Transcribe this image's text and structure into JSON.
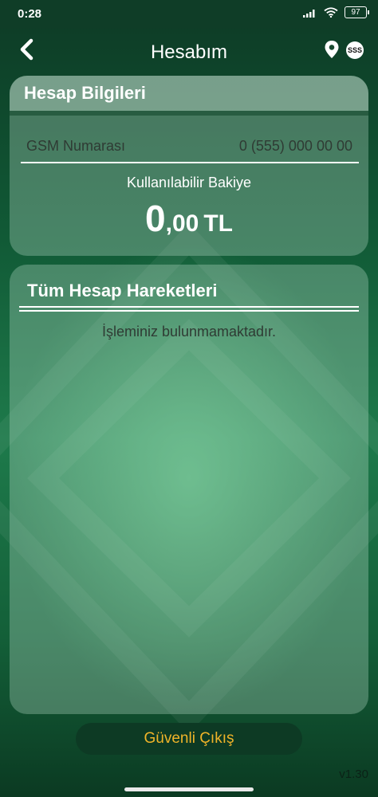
{
  "status": {
    "time": "0:28",
    "battery": "97"
  },
  "header": {
    "title": "Hesabım",
    "faq_label": "SSS"
  },
  "account_info": {
    "title": "Hesap Bilgileri",
    "gsm_label": "GSM Numarası",
    "gsm_value": "0 (555) 000 00 00",
    "balance_label": "Kullanılabilir Bakiye",
    "balance_integer": "0",
    "balance_decimal": ",00",
    "balance_currency": "TL"
  },
  "transactions": {
    "title": "Tüm Hesap Hareketleri",
    "empty_message": "İşleminiz bulunmamaktadır."
  },
  "footer": {
    "logout_label": "Güvenli Çıkış",
    "version": "v1.30"
  },
  "colors": {
    "logout_text": "#f0b429",
    "background": "#1e7a4b"
  }
}
